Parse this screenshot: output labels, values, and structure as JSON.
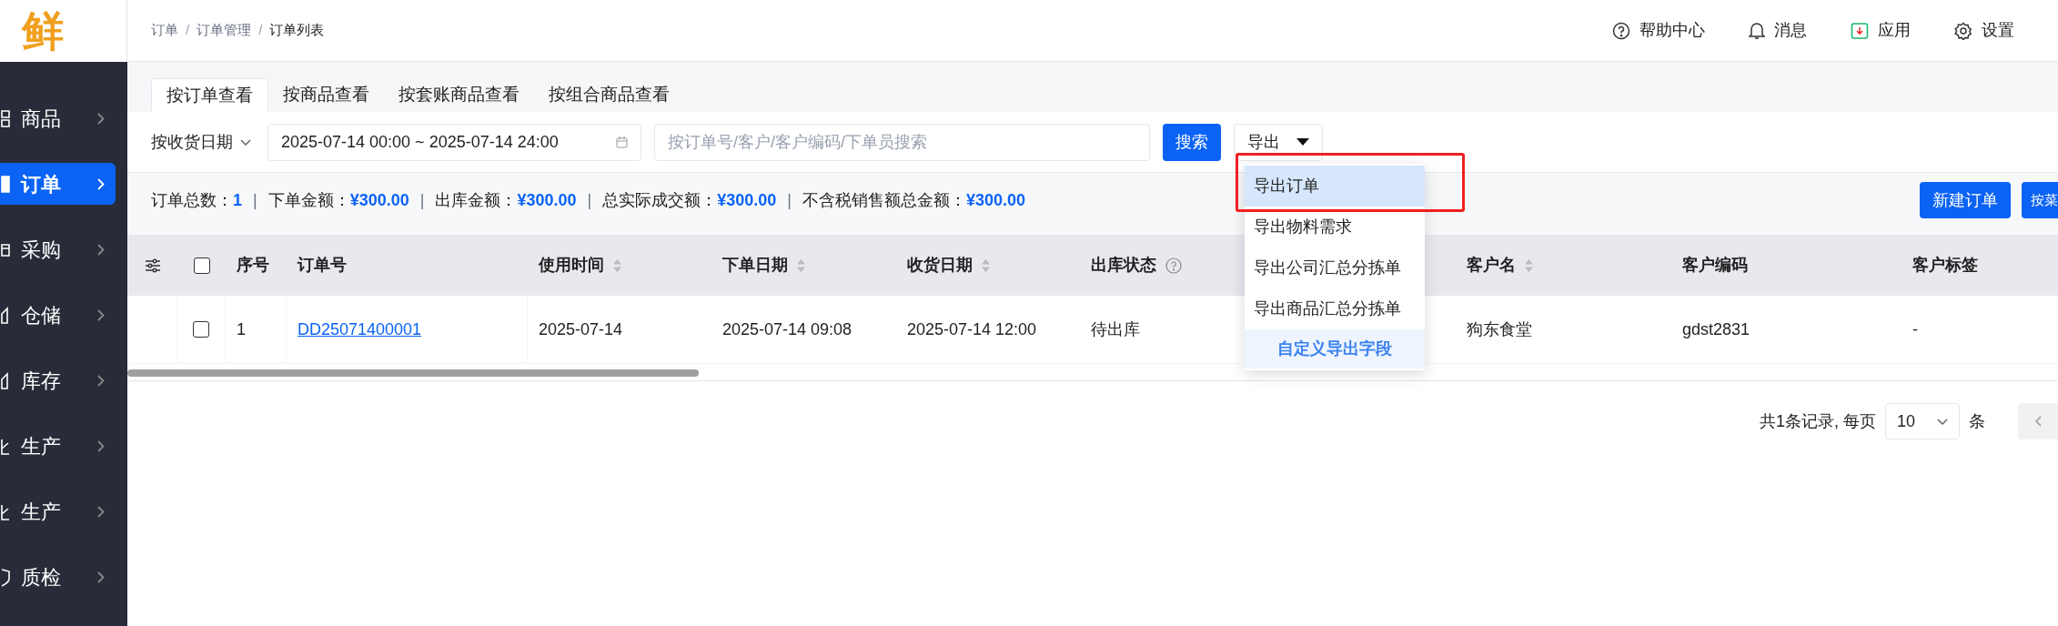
{
  "sidebar": {
    "logo": "鲜",
    "items": [
      {
        "label": "商品",
        "kind": "grid",
        "selected": false
      },
      {
        "label": "订单",
        "kind": "doc",
        "selected": true
      },
      {
        "label": "采购",
        "kind": "cart",
        "selected": false
      },
      {
        "label": "仓储",
        "kind": "house",
        "selected": false
      },
      {
        "label": "库存",
        "kind": "house",
        "selected": false
      },
      {
        "label": "生产",
        "kind": "flag",
        "selected": false
      },
      {
        "label": "生产",
        "kind": "flag",
        "selected": false
      },
      {
        "label": "质检",
        "kind": "shield",
        "selected": false
      }
    ]
  },
  "header": {
    "breadcrumb": [
      "订单",
      "订单管理",
      "订单列表"
    ],
    "breadcrumb_separator": "/",
    "actions": [
      {
        "label": "帮助中心",
        "kind": "help"
      },
      {
        "label": "消息",
        "kind": "bell"
      },
      {
        "label": "应用",
        "kind": "app"
      },
      {
        "label": "设置",
        "kind": "gear"
      }
    ]
  },
  "tabs": [
    {
      "label": "按订单查看",
      "selected": true
    },
    {
      "label": "按商品查看",
      "selected": false
    },
    {
      "label": "按套账商品查看",
      "selected": false
    },
    {
      "label": "按组合商品查看",
      "selected": false
    }
  ],
  "filters": {
    "date_type": "按收货日期",
    "date_range": "2025-07-14 00:00 ~ 2025-07-14 24:00",
    "search": {
      "placeholder": "按订单号/客户/客户编码/下单员搜索"
    },
    "search_button": "搜索",
    "export_button": "导出",
    "export_menu": [
      {
        "label": "导出订单",
        "kind": "item",
        "highlighted": true
      },
      {
        "label": "导出物料需求",
        "kind": "item",
        "highlighted": false
      },
      {
        "label": "导出公司汇总分拣单",
        "kind": "item",
        "highlighted": false
      },
      {
        "label": "导出商品汇总分拣单",
        "kind": "item",
        "highlighted": false
      },
      {
        "label": "自定义导出字段",
        "kind": "custom",
        "highlighted": false
      }
    ]
  },
  "summary_separator": "|",
  "summary": [
    {
      "label": "订单总数：",
      "value": "1"
    },
    {
      "label": "下单金额：",
      "value": "¥300.00"
    },
    {
      "label": "出库金额：",
      "value": "¥300.00"
    },
    {
      "label": "总实际成交额：",
      "value": "¥300.00"
    },
    {
      "label": "不含税销售额总金额：",
      "value": "¥300.00"
    }
  ],
  "actions": [
    "新建订单",
    "按菜"
  ],
  "table": {
    "columns": [
      {
        "label": "序号",
        "sortable": false,
        "help": false
      },
      {
        "label": "订单号",
        "sortable": false,
        "help": false
      },
      {
        "label": "使用时间",
        "sortable": true,
        "help": false
      },
      {
        "label": "下单日期",
        "sortable": true,
        "help": false
      },
      {
        "label": "收货日期",
        "sortable": true,
        "help": false
      },
      {
        "label": "出库状态",
        "sortable": false,
        "help": true
      },
      {
        "label": "客户名",
        "sortable": true,
        "help": false
      },
      {
        "label": "客户编码",
        "sortable": false,
        "help": false
      },
      {
        "label": "客户标签",
        "sortable": false,
        "help": false
      }
    ],
    "header_checked": false,
    "rows": [
      {
        "checked": false,
        "cells": [
          "1",
          "DD25071400001",
          "2025-07-14",
          "2025-07-14 09:08",
          "2025-07-14 12:00",
          "待出库",
          "狗东食堂",
          "gdst2831",
          "-"
        ]
      }
    ]
  },
  "pagination": {
    "total": "共1条记录, 每页",
    "page_size": "10",
    "unit": "条"
  }
}
